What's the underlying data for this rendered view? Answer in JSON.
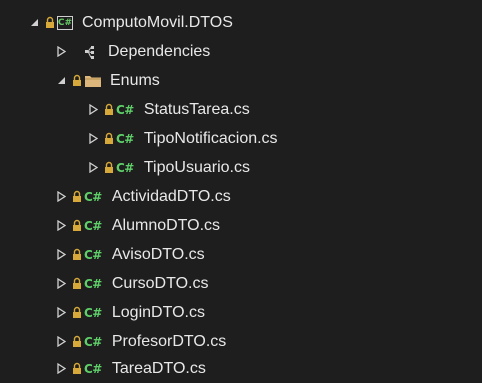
{
  "tree": {
    "project": {
      "label": "ComputoMovil.DTOS",
      "icon": "csharp-project-icon",
      "expanded": true
    },
    "dependencies": {
      "label": "Dependencies",
      "icon": "dependencies-icon"
    },
    "enums_folder": {
      "label": "Enums",
      "icon": "folder-icon",
      "expanded": true,
      "files": [
        {
          "label": "StatusTarea.cs"
        },
        {
          "label": "TipoNotificacion.cs"
        },
        {
          "label": "TipoUsuario.cs"
        }
      ]
    },
    "files": [
      {
        "label": "ActividadDTO.cs"
      },
      {
        "label": "AlumnoDTO.cs"
      },
      {
        "label": "AvisoDTO.cs"
      },
      {
        "label": "CursoDTO.cs"
      },
      {
        "label": "LoginDTO.cs"
      },
      {
        "label": "ProfesorDTO.cs"
      },
      {
        "label": "TareaDTO.cs"
      }
    ],
    "csharp_badge": "C#",
    "project_badge": "C#"
  },
  "colors": {
    "background": "#1e1e1e",
    "text": "#e8e8e8",
    "csharp_green": "#5fd069",
    "lock_gold": "#d6a93a",
    "folder_yellow": "#dcb67a"
  }
}
